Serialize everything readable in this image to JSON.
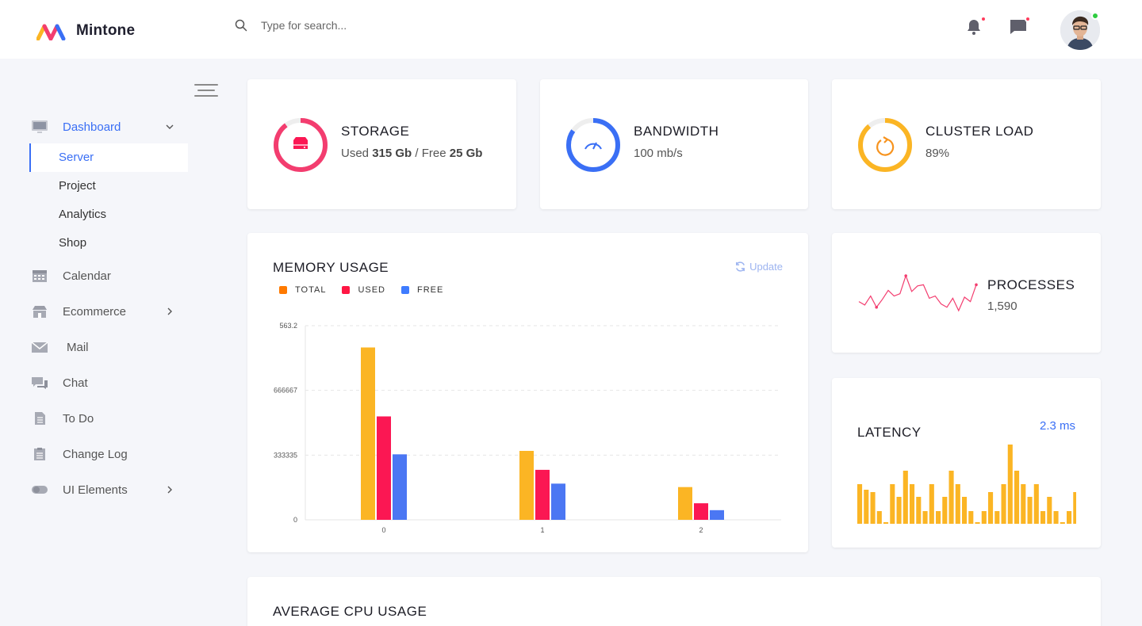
{
  "app": {
    "name": "Mintone"
  },
  "search": {
    "placeholder": "Type for search..."
  },
  "sidebar": {
    "items": [
      {
        "label": "Dashboard",
        "icon": "monitor-icon",
        "active": true,
        "submenu": [
          "Server",
          "Project",
          "Analytics",
          "Shop"
        ],
        "active_sub": "Server"
      },
      {
        "label": "Calendar",
        "icon": "calendar-icon"
      },
      {
        "label": "Ecommerce",
        "icon": "store-icon",
        "has_children": true
      },
      {
        "label": "Mail",
        "icon": "mail-icon"
      },
      {
        "label": "Chat",
        "icon": "chat-icon"
      },
      {
        "label": "To Do",
        "icon": "document-icon"
      },
      {
        "label": "Change Log",
        "icon": "clipboard-icon"
      },
      {
        "label": "UI Elements",
        "icon": "toggle-icon",
        "has_children": true
      }
    ]
  },
  "stats": {
    "storage": {
      "title": "STORAGE",
      "used_prefix": "Used ",
      "used": "315 Gb",
      "sep": " / Free ",
      "free": "25 Gb",
      "color": "#f33d6f"
    },
    "bandwidth": {
      "title": "BANDWIDTH",
      "value": "100 mb/s",
      "color": "#3a6ff5"
    },
    "cluster": {
      "title": "CLUSTER LOAD",
      "value": "89%",
      "color": "#fbb524"
    }
  },
  "processes": {
    "title": "PROCESSES",
    "value": "1,590"
  },
  "latency": {
    "title": "LATENCY",
    "value": "2.3 ms"
  },
  "memory": {
    "title": "MEMORY USAGE",
    "update_label": "Update"
  },
  "cpu": {
    "title": "AVERAGE CPU USAGE"
  },
  "colors": {
    "orange": "#fbb524",
    "red": "#fb1753",
    "blue": "#4b77f3",
    "legend_total": "#ff7a00",
    "legend_used": "#ff1744",
    "legend_free": "#3f7cff"
  },
  "chart_data": [
    {
      "type": "bar",
      "title": "MEMORY USAGE",
      "categories": [
        "0",
        "1",
        "2"
      ],
      "series": [
        {
          "name": "TOTAL",
          "values": [
            500,
            200,
            95
          ]
        },
        {
          "name": "USED",
          "values": [
            300,
            145,
            48
          ]
        },
        {
          "name": "FREE",
          "values": [
            190,
            105,
            28
          ]
        }
      ],
      "ylim": [
        0,
        563.2
      ],
      "y_ticks": [
        "0",
        "333335",
        "666667",
        "563.2"
      ],
      "grid": true,
      "legend": "top-left"
    },
    {
      "type": "line",
      "title": "PROCESSES",
      "values": [
        15,
        12,
        20,
        10,
        17,
        25,
        20,
        22,
        38,
        24,
        29,
        30,
        18,
        20,
        13,
        10,
        18,
        7,
        19,
        15,
        30
      ]
    },
    {
      "type": "bar",
      "title": "LATENCY",
      "values": [
        50,
        43,
        40,
        16,
        2,
        50,
        34,
        67,
        50,
        34,
        16,
        50,
        16,
        34,
        67,
        50,
        34,
        16,
        2,
        16,
        40,
        16,
        50,
        100,
        67,
        50,
        34,
        50,
        16,
        34,
        16,
        2,
        16,
        40
      ]
    }
  ]
}
